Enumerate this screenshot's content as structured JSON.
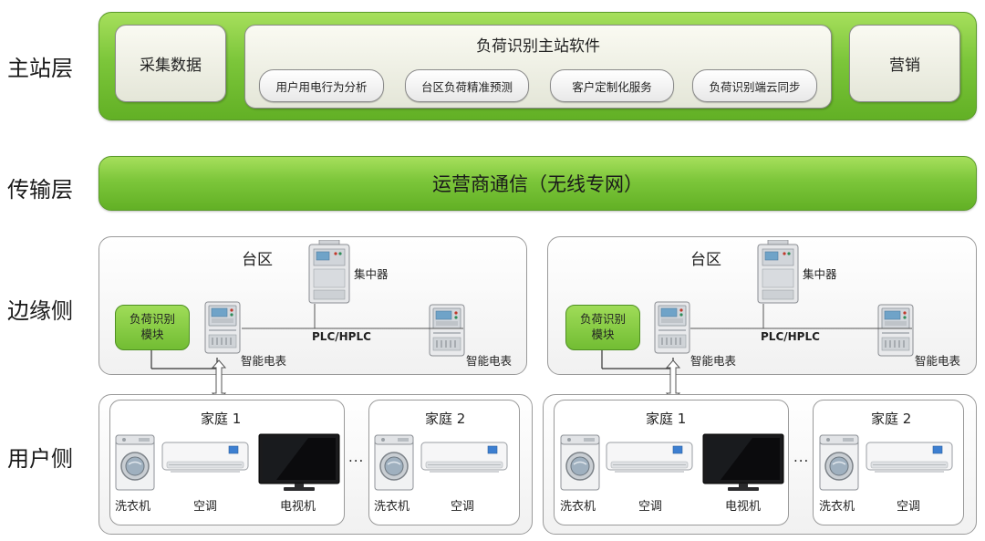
{
  "layers": {
    "master": "主站层",
    "transport": "传输层",
    "edge": "边缘侧",
    "user": "用户侧"
  },
  "master": {
    "collect": "采集数据",
    "software": {
      "title": "负荷识别主站软件",
      "chips": [
        "用户用电行为分析",
        "台区负荷精准预测",
        "客户定制化服务",
        "负荷识别端云同步"
      ]
    },
    "marketing": "营销"
  },
  "transport": {
    "label": "运营商通信（无线专网）"
  },
  "edge_panels": [
    {
      "title": "台区",
      "concentrator": "集中器",
      "module_line1": "负荷识别",
      "module_line2": "模块",
      "link": "PLC/HPLC",
      "meter_left": "智能电表",
      "meter_right": "智能电表"
    },
    {
      "title": "台区",
      "concentrator": "集中器",
      "module_line1": "负荷识别",
      "module_line2": "模块",
      "link": "PLC/HPLC",
      "meter_left": "智能电表",
      "meter_right": "智能电表"
    }
  ],
  "user_panels": [
    {
      "home1": {
        "title": "家庭 1",
        "washer": "洗衣机",
        "ac": "空调",
        "tv": "电视机"
      },
      "ellipsis": "...",
      "home2": {
        "title": "家庭 2",
        "washer": "洗衣机",
        "ac": "空调"
      }
    },
    {
      "home1": {
        "title": "家庭 1",
        "washer": "洗衣机",
        "ac": "空调",
        "tv": "电视机"
      },
      "ellipsis": "...",
      "home2": {
        "title": "家庭 2",
        "washer": "洗衣机",
        "ac": "空调"
      }
    }
  ],
  "colors": {
    "green_band": "#7cc63a",
    "green_border": "#5a9a2a",
    "gray_box": "#e4e6d8",
    "meter_screen": "#6fa3c8"
  },
  "icons": [
    "smart-meter-icon",
    "concentrator-icon",
    "washing-machine-icon",
    "air-conditioner-icon",
    "television-icon"
  ]
}
